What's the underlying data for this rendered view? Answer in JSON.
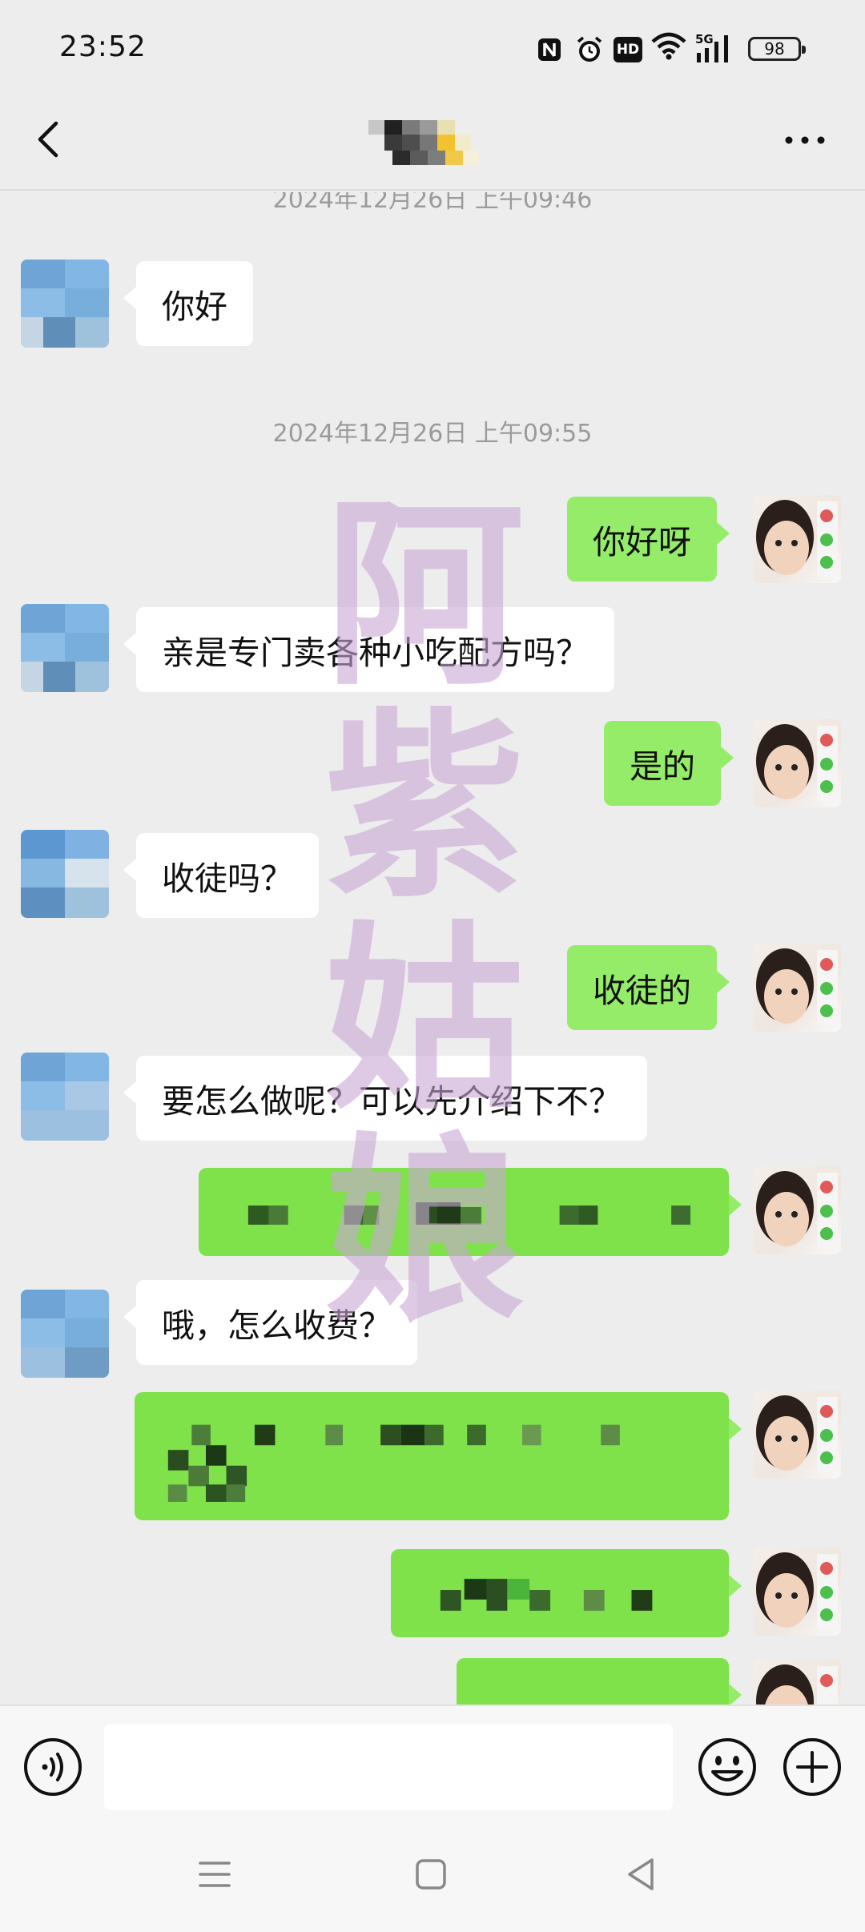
{
  "status_bar": {
    "time": "23:52",
    "battery_level": "98",
    "network": "5G",
    "hd_label": "HD",
    "icons": [
      "nfc-icon",
      "alarm-icon",
      "hd-icon",
      "wifi-icon",
      "signal-icon",
      "battery-icon"
    ]
  },
  "title_bar": {
    "contact_name": "",
    "back_icon": "chevron-left-icon",
    "more_icon": "more-icon"
  },
  "chat": {
    "cut_timestamp": "2024年12月26日 上午09:46",
    "timestamp_2": "2024年12月26日 上午09:55",
    "messages": [
      {
        "from": "them",
        "text": "你好"
      },
      {
        "from": "me",
        "text": "你好呀"
      },
      {
        "from": "them",
        "text": "亲是专门卖各种小吃配方吗？"
      },
      {
        "from": "me",
        "text": "是的"
      },
      {
        "from": "them",
        "text": "收徒吗？"
      },
      {
        "from": "me",
        "text": "收徒的"
      },
      {
        "from": "them",
        "text": "要怎么做呢？可以先介绍下不？"
      },
      {
        "from": "me",
        "text": "",
        "obscured": true
      },
      {
        "from": "them",
        "text": "哦，怎么收费？"
      },
      {
        "from": "me",
        "text": "",
        "obscured": true
      },
      {
        "from": "me",
        "text": "",
        "obscured": true
      },
      {
        "from": "me",
        "text": "",
        "obscured": true
      }
    ],
    "watermark": "阿紫姑娘"
  },
  "input_bar": {
    "voice_icon": "voice-icon",
    "input_value": "",
    "emoji_icon": "emoji-icon",
    "plus_icon": "plus-icon"
  },
  "nav_bar": {
    "icons": [
      "menu-icon",
      "home-icon",
      "back-icon"
    ]
  },
  "colors": {
    "background": "#ededed",
    "outgoing_bubble": "#95ec69",
    "incoming_bubble": "#ffffff",
    "timestamp": "#9b9b9b",
    "watermark": "#c9a6d6"
  }
}
